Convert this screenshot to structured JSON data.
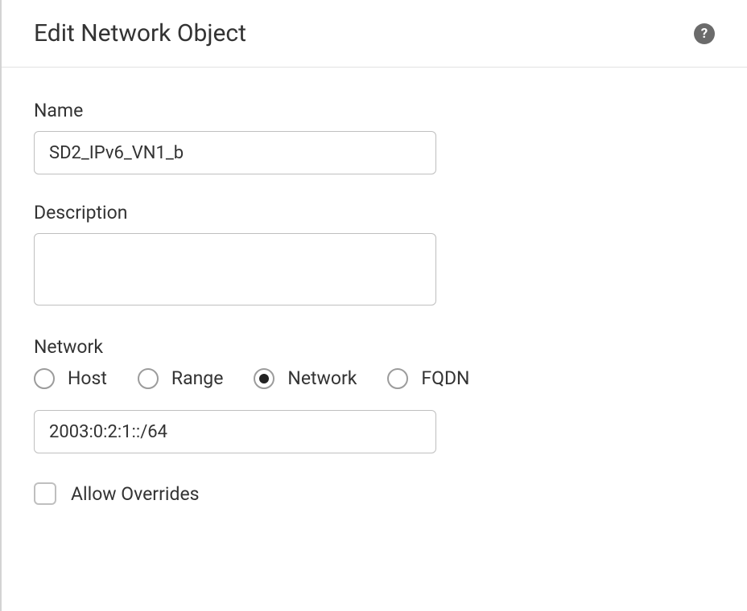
{
  "header": {
    "title": "Edit Network Object",
    "help_symbol": "?"
  },
  "form": {
    "name": {
      "label": "Name",
      "value": "SD2_IPv6_VN1_b"
    },
    "description": {
      "label": "Description",
      "value": ""
    },
    "network": {
      "label": "Network",
      "options": [
        {
          "label": "Host",
          "selected": false
        },
        {
          "label": "Range",
          "selected": false
        },
        {
          "label": "Network",
          "selected": true
        },
        {
          "label": "FQDN",
          "selected": false
        }
      ],
      "value": "2003:0:2:1::/64"
    },
    "allow_overrides": {
      "label": "Allow Overrides",
      "checked": false
    }
  }
}
